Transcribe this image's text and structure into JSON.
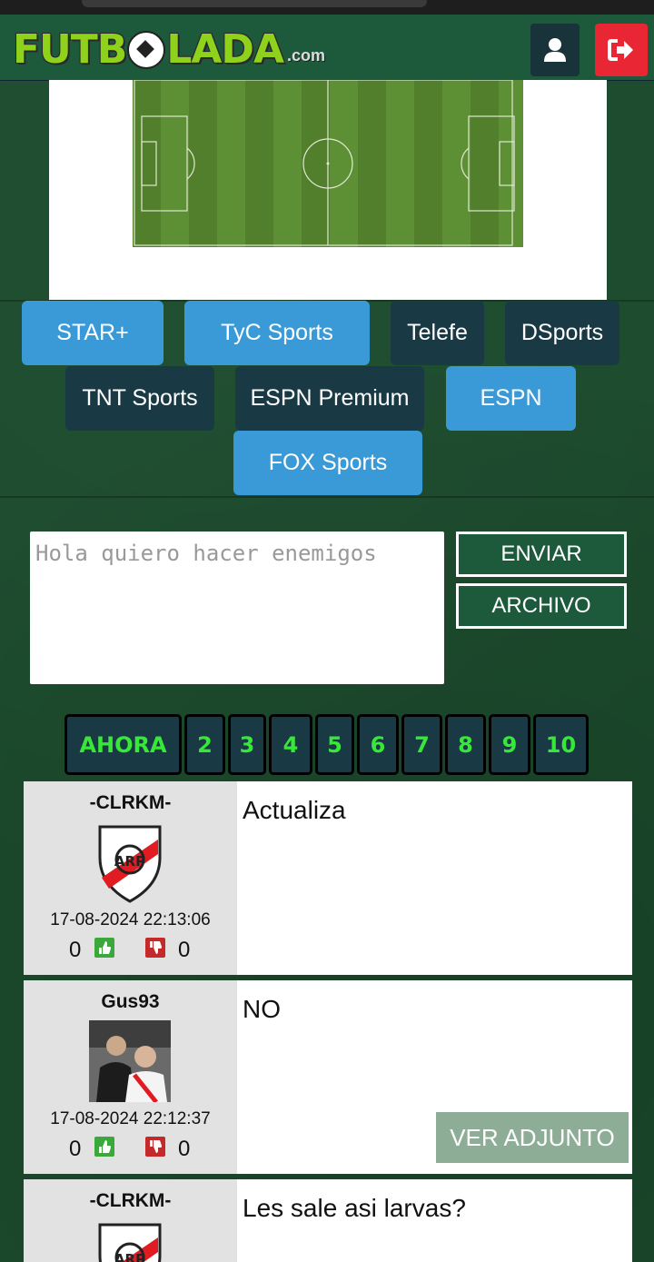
{
  "header": {
    "logo_text_left": "FUTB",
    "logo_text_right": "LADA",
    "logo_suffix": ".com"
  },
  "channels": [
    {
      "label": "STAR+",
      "state": "active"
    },
    {
      "label": "TyC Sports",
      "state": "active"
    },
    {
      "label": "Telefe",
      "state": "dark"
    },
    {
      "label": "DSports",
      "state": "dark"
    },
    {
      "label": "TNT Sports",
      "state": "dark"
    },
    {
      "label": "ESPN Premium",
      "state": "dark"
    },
    {
      "label": "ESPN",
      "state": "active"
    },
    {
      "label": "FOX Sports",
      "state": "active"
    }
  ],
  "composer": {
    "placeholder": "Hola quiero hacer enemigos",
    "send_label": "ENVIAR",
    "file_label": "ARCHIVO"
  },
  "pagination": [
    "AHORA",
    "2",
    "3",
    "4",
    "5",
    "6",
    "7",
    "8",
    "9",
    "10"
  ],
  "posts": [
    {
      "user": "-CLRKM-",
      "avatar": "river-plate-shield-icon",
      "date": "17-08-2024 22:13:06",
      "likes": "0",
      "dislikes": "0",
      "text": "Actualiza"
    },
    {
      "user": "Gus93",
      "avatar": "user-photo",
      "date": "17-08-2024 22:12:37",
      "likes": "0",
      "dislikes": "0",
      "text": "NO",
      "attachment_label": "VER ADJUNTO"
    },
    {
      "user": "-CLRKM-",
      "avatar": "river-plate-shield-icon",
      "text": "Les sale asi larvas?"
    }
  ],
  "colors": {
    "header_bg": "#1c5a3b",
    "channel_active": "#3a9ad8",
    "channel_dark": "#193a44",
    "logout_red": "#e82634",
    "pagination_text": "#38e838"
  }
}
